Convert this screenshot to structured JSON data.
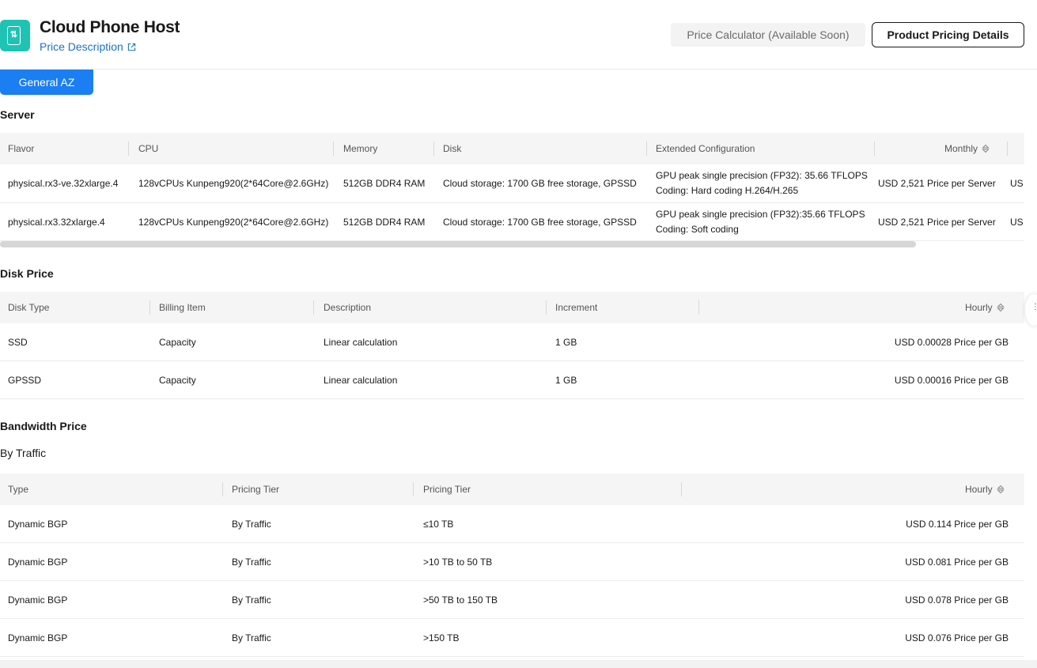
{
  "header": {
    "title": "Cloud Phone Host",
    "price_description": "Price Description",
    "calc_button": "Price Calculator (Available Soon)",
    "pricing_button": "Product Pricing Details",
    "icon": "phone-app-icon"
  },
  "az_tab": "General AZ",
  "server": {
    "title": "Server",
    "columns": [
      "Flavor",
      "CPU",
      "Memory",
      "Disk",
      "Extended Configuration",
      "Monthly"
    ],
    "rows": [
      {
        "flavor": "physical.rx3-ve.32xlarge.4",
        "cpu": "128vCPUs Kunpeng920(2*64Core@2.6GHz)",
        "memory": "512GB DDR4 RAM",
        "disk": "Cloud storage: 1700 GB free storage, GPSSD",
        "ext1": "GPU peak single precision (FP32): 35.66 TFLOPS",
        "ext2": "Coding: Hard coding H.264/H.265",
        "monthly": "USD 2,521 Price per Server",
        "overflow": "US"
      },
      {
        "flavor": "physical.rx3.32xlarge.4",
        "cpu": "128vCPUs Kunpeng920(2*64Core@2.6GHz)",
        "memory": "512GB DDR4 RAM",
        "disk": "Cloud storage: 1700 GB free storage, GPSSD",
        "ext1": "GPU peak single precision (FP32):35.66 TFLOPS",
        "ext2": "Coding: Soft coding",
        "monthly": "USD 2,521 Price per Server",
        "overflow": "US"
      }
    ]
  },
  "disk": {
    "title": "Disk Price",
    "columns": [
      "Disk Type",
      "Billing Item",
      "Description",
      "Increment",
      "Hourly"
    ],
    "rows": [
      {
        "type": "SSD",
        "billing": "Capacity",
        "desc": "Linear calculation",
        "inc": "1 GB",
        "price": "USD 0.00028 Price per GB"
      },
      {
        "type": "GPSSD",
        "billing": "Capacity",
        "desc": "Linear calculation",
        "inc": "1 GB",
        "price": "USD 0.00016 Price per GB"
      }
    ]
  },
  "bandwidth": {
    "title": "Bandwidth Price",
    "subtitle": "By Traffic",
    "columns": [
      "Type",
      "Pricing Tier",
      "Pricing Tier",
      "Hourly"
    ],
    "rows": [
      {
        "type": "Dynamic BGP",
        "tier1": "By Traffic",
        "tier2": "≤10 TB",
        "price": "USD 0.114 Price per GB"
      },
      {
        "type": "Dynamic BGP",
        "tier1": "By Traffic",
        "tier2": ">10 TB to 50 TB",
        "price": "USD 0.081 Price per GB"
      },
      {
        "type": "Dynamic BGP",
        "tier1": "By Traffic",
        "tier2": ">50 TB to 150 TB",
        "price": "USD 0.078 Price per GB"
      },
      {
        "type": "Dynamic BGP",
        "tier1": "By Traffic",
        "tier2": ">150 TB",
        "price": "USD 0.076 Price per GB"
      }
    ]
  },
  "colors": {
    "accent": "#1b7ef2",
    "icon_bg": "#1ec3b4",
    "link": "#1a73c4"
  }
}
